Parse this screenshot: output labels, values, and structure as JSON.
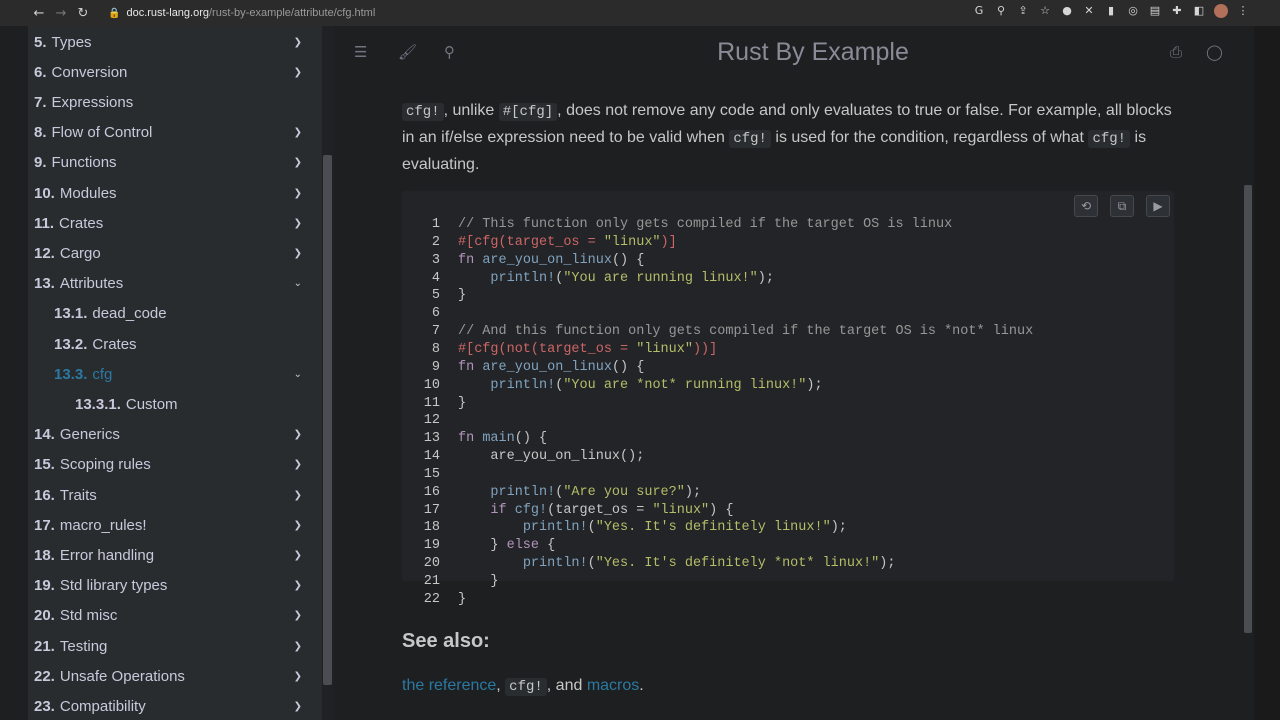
{
  "browser": {
    "back": "←",
    "forward": "→",
    "reload": "↻",
    "url_host": "doc.rust-lang.org",
    "url_path": "/rust-by-example/attribute/cfg.html"
  },
  "sidebar": {
    "items": [
      {
        "num": "5.",
        "label": "Types",
        "arrow": "❯"
      },
      {
        "num": "6.",
        "label": "Conversion",
        "arrow": "❯"
      },
      {
        "num": "7.",
        "label": "Expressions",
        "arrow": ""
      },
      {
        "num": "8.",
        "label": "Flow of Control",
        "arrow": "❯"
      },
      {
        "num": "9.",
        "label": "Functions",
        "arrow": "❯"
      },
      {
        "num": "10.",
        "label": "Modules",
        "arrow": "❯"
      },
      {
        "num": "11.",
        "label": "Crates",
        "arrow": "❯"
      },
      {
        "num": "12.",
        "label": "Cargo",
        "arrow": "❯"
      },
      {
        "num": "13.",
        "label": "Attributes",
        "arrow": "⌄"
      },
      {
        "num": "13.1.",
        "label": "dead_code",
        "arrow": ""
      },
      {
        "num": "13.2.",
        "label": "Crates",
        "arrow": ""
      },
      {
        "num": "13.3.",
        "label": "cfg",
        "arrow": "⌄"
      },
      {
        "num": "13.3.1.",
        "label": "Custom",
        "arrow": ""
      },
      {
        "num": "14.",
        "label": "Generics",
        "arrow": "❯"
      },
      {
        "num": "15.",
        "label": "Scoping rules",
        "arrow": "❯"
      },
      {
        "num": "16.",
        "label": "Traits",
        "arrow": "❯"
      },
      {
        "num": "17.",
        "label": "macro_rules!",
        "arrow": "❯"
      },
      {
        "num": "18.",
        "label": "Error handling",
        "arrow": "❯"
      },
      {
        "num": "19.",
        "label": "Std library types",
        "arrow": "❯"
      },
      {
        "num": "20.",
        "label": "Std misc",
        "arrow": "❯"
      },
      {
        "num": "21.",
        "label": "Testing",
        "arrow": "❯"
      },
      {
        "num": "22.",
        "label": "Unsafe Operations",
        "arrow": "❯"
      },
      {
        "num": "23.",
        "label": "Compatibility",
        "arrow": "❯"
      }
    ]
  },
  "header": {
    "title": "Rust By Example",
    "menu_icon": "☰",
    "theme_icon": "🖌",
    "search_icon": "⚲",
    "print_icon": "⎙",
    "github_icon": "◯"
  },
  "intro": {
    "t1": "cfg!",
    "t2": ", unlike ",
    "t3": "#[cfg]",
    "t4": ", does not remove any code and only evaluates to true or false. For example, all blocks in an if/else expression need to be valid when ",
    "t5": "cfg!",
    "t6": " is used for the condition, regardless of what ",
    "t7": "cfg!",
    "t8": " is evaluating."
  },
  "code": {
    "buttons": {
      "undo": "⟲",
      "copy": "⧉",
      "run": "▶"
    },
    "lines": [
      "1",
      "2",
      "3",
      "4",
      "5",
      "6",
      "7",
      "8",
      "9",
      "10",
      "11",
      "12",
      "13",
      "14",
      "15",
      "16",
      "17",
      "18",
      "19",
      "20",
      "21",
      "22"
    ]
  },
  "see_also": {
    "heading": "See also:",
    "link1": "the reference",
    "sep1": ", ",
    "code": "cfg!",
    "sep2": ", and ",
    "link2": "macros",
    "end": "."
  }
}
